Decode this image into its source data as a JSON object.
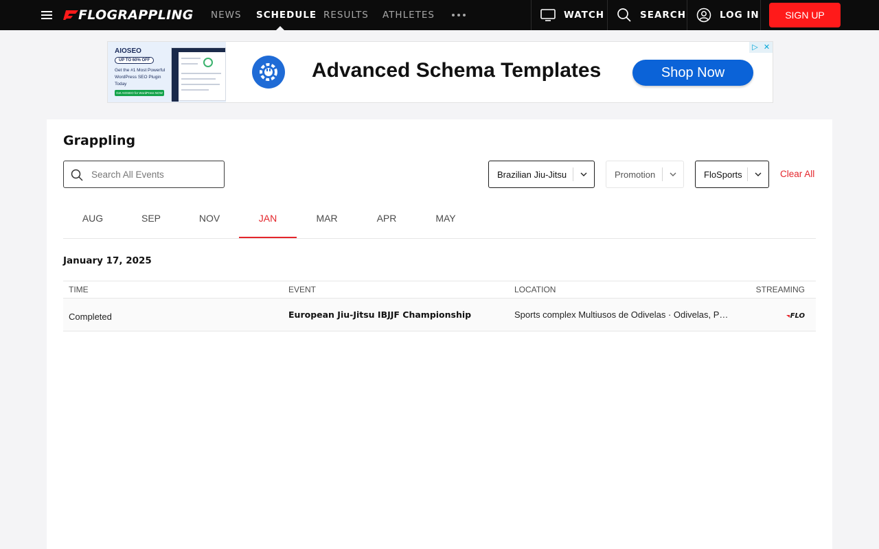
{
  "nav": {
    "logo": "FLOGRAPPLING",
    "links": [
      {
        "label": "NEWS",
        "active": false
      },
      {
        "label": "SCHEDULE",
        "active": true
      },
      {
        "label": "RESULTS",
        "active": false
      },
      {
        "label": "ATHLETES",
        "active": false
      }
    ],
    "watch_label": "WATCH",
    "search_label": "SEARCH",
    "login_label": "LOG IN",
    "signup_label": "SIGN UP"
  },
  "ad": {
    "thumb_brand": "AIOSEO",
    "thumb_offer": "UP TO 60% OFF",
    "thumb_copy": "Get the #1 Most Powerful WordPress SEO Plugin Today",
    "thumb_cta": "Get AIOSEO for WordPress NOW",
    "headline": "Advanced Schema Templates",
    "cta": "Shop Now"
  },
  "page": {
    "title": "Grappling",
    "search_placeholder": "Search All Events",
    "filters": {
      "sport": "Brazilian Jiu-Jitsu",
      "promotion": "Promotion",
      "platform": "FloSports"
    },
    "clear_all": "Clear All",
    "months": [
      "AUG",
      "SEP",
      "NOV",
      "JAN",
      "MAR",
      "APR",
      "MAY"
    ],
    "active_month": "JAN",
    "date_heading": "January 17, 2025",
    "table": {
      "headers": {
        "time": "TIME",
        "event": "EVENT",
        "location": "LOCATION",
        "streaming": "STREAMING"
      },
      "rows": [
        {
          "time": "Completed",
          "event": "European Jiu-Jitsu IBJJF Championship",
          "location": "Sports complex Multiusos de Odivelas · Odivelas, Portugal",
          "streaming": "FLO"
        }
      ]
    }
  },
  "colors": {
    "accent": "#e4252b",
    "signup": "#ff1a1a",
    "nav_bg": "#0c0c0c",
    "page_bg": "#f4f4f6"
  }
}
